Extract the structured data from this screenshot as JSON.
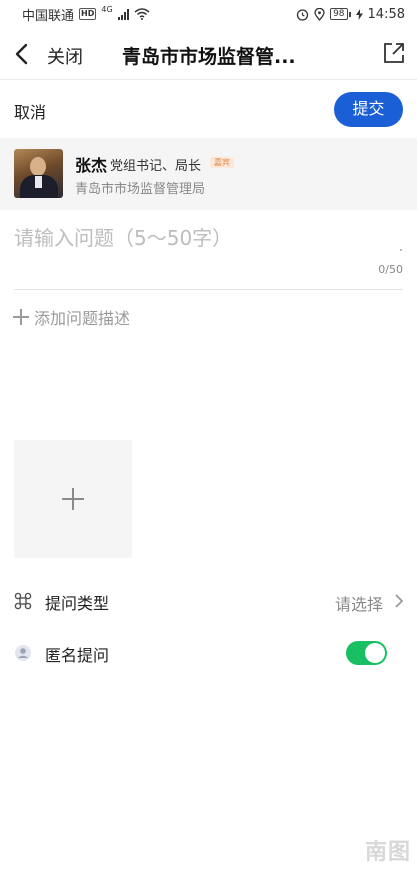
{
  "status_bar": {
    "carrier": "中国联通",
    "hd": "HD",
    "network": "4G",
    "battery": "98",
    "time": "14:58"
  },
  "nav": {
    "close_label": "关闭",
    "title": "青岛市市场监督管..."
  },
  "actions": {
    "cancel_label": "取消",
    "submit_label": "提交"
  },
  "recipient": {
    "name": "张杰",
    "position": "党组书记、局长",
    "tag": "嘉宾",
    "organization": "青岛市市场监督管理局"
  },
  "question": {
    "placeholder": "请输入问题（5～50字）",
    "counter": "0/50"
  },
  "description": {
    "add_label": "添加问题描述"
  },
  "form": {
    "type_label": "提问类型",
    "type_value": "请选择",
    "anonymous_label": "匿名提问",
    "anonymous_on": true
  },
  "watermark": "南图",
  "colors": {
    "primary": "#1a5fd6",
    "toggle_on": "#19c063",
    "tag_text": "#e08a4a"
  }
}
